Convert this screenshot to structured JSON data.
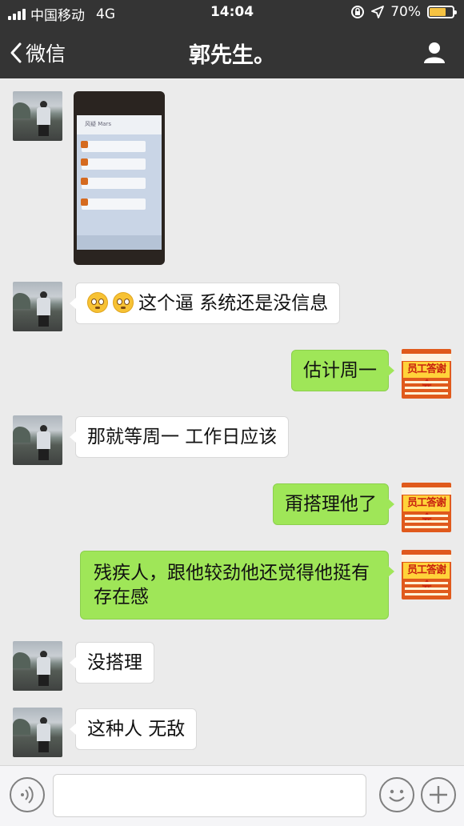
{
  "status_bar": {
    "carrier": "中国移动",
    "network": "4G",
    "time": "14:04",
    "battery": "70%",
    "battery_level": 0.7
  },
  "nav": {
    "back_label": "微信",
    "title": "郭先生。"
  },
  "messages": [
    {
      "side": "left",
      "type": "image"
    },
    {
      "side": "left",
      "type": "text",
      "text": "这个逼 系统还是没信息"
    },
    {
      "side": "right",
      "type": "text",
      "text": "估计周一"
    },
    {
      "side": "left",
      "type": "text",
      "text": "那就等周一 工作日应该"
    },
    {
      "side": "right",
      "type": "text",
      "text": "甭搭理他了"
    },
    {
      "side": "right",
      "type": "text",
      "text": "残疾人，跟他较劲他还觉得他挺有存在感"
    },
    {
      "side": "left",
      "type": "text",
      "text": "没搭理"
    },
    {
      "side": "left",
      "type": "text",
      "text": "这种人 无敌"
    }
  ],
  "photo": {
    "header_text": "风疑  Mars"
  },
  "avatar_right": {
    "headline": "员工答谢会"
  },
  "colors": {
    "nav_bg": "#343434",
    "chat_bg": "#ebebeb",
    "bubble_sent": "#9fe658",
    "bubble_received": "#ffffff"
  }
}
